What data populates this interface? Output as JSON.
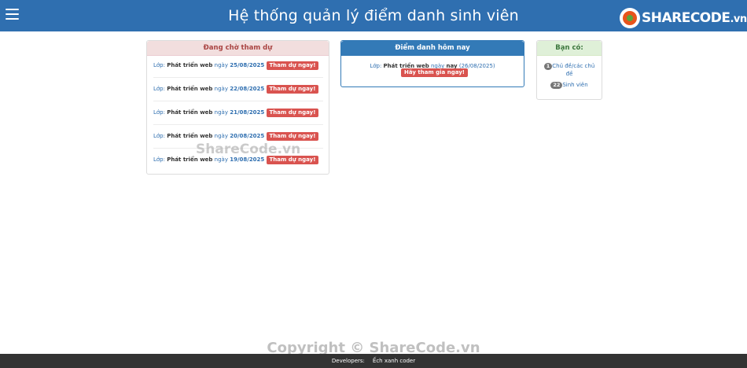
{
  "header": {
    "title": "Hệ thống quản lý điểm danh sinh viên",
    "logo_text": "SHARECODE",
    "logo_suffix": ".vn"
  },
  "pending": {
    "title": "Đang chờ tham dự",
    "rows": [
      {
        "label": "Lớp:",
        "class_name": "Phát triển web",
        "date_word": "ngày",
        "date": "25/08/2025",
        "button": "Tham dự ngay!"
      },
      {
        "label": "Lớp:",
        "class_name": "Phát triển web",
        "date_word": "ngày",
        "date": "22/08/2025",
        "button": "Tham dự ngay!"
      },
      {
        "label": "Lớp:",
        "class_name": "Phát triển web",
        "date_word": "ngày",
        "date": "21/08/2025",
        "button": "Tham dự ngay!"
      },
      {
        "label": "Lớp:",
        "class_name": "Phát triển web",
        "date_word": "ngày",
        "date": "20/08/2025",
        "button": "Tham dự ngay!"
      },
      {
        "label": "Lớp:",
        "class_name": "Phát triển web",
        "date_word": "ngày",
        "date": "19/08/2025",
        "button": "Tham dự ngay!"
      }
    ]
  },
  "today": {
    "title": "Điểm danh hôm nay",
    "label": "Lớp:",
    "class_name": "Phát triển web",
    "date_word": "ngày",
    "today_word": "nay",
    "date": "(26/08/2025)",
    "button": "Hãy tham gia ngay!"
  },
  "you": {
    "title": "Bạn có:",
    "topics_count": "1",
    "topics_label": "Chủ đề/các chủ đề",
    "students_count": "22",
    "students_label": "Sinh viên"
  },
  "watermarks": {
    "middle": "ShareCode.vn",
    "bottom": "Copyright © ShareCode.vn"
  },
  "footer": {
    "developers_label": "Developers:",
    "developer_name": "Ếch xanh coder"
  }
}
